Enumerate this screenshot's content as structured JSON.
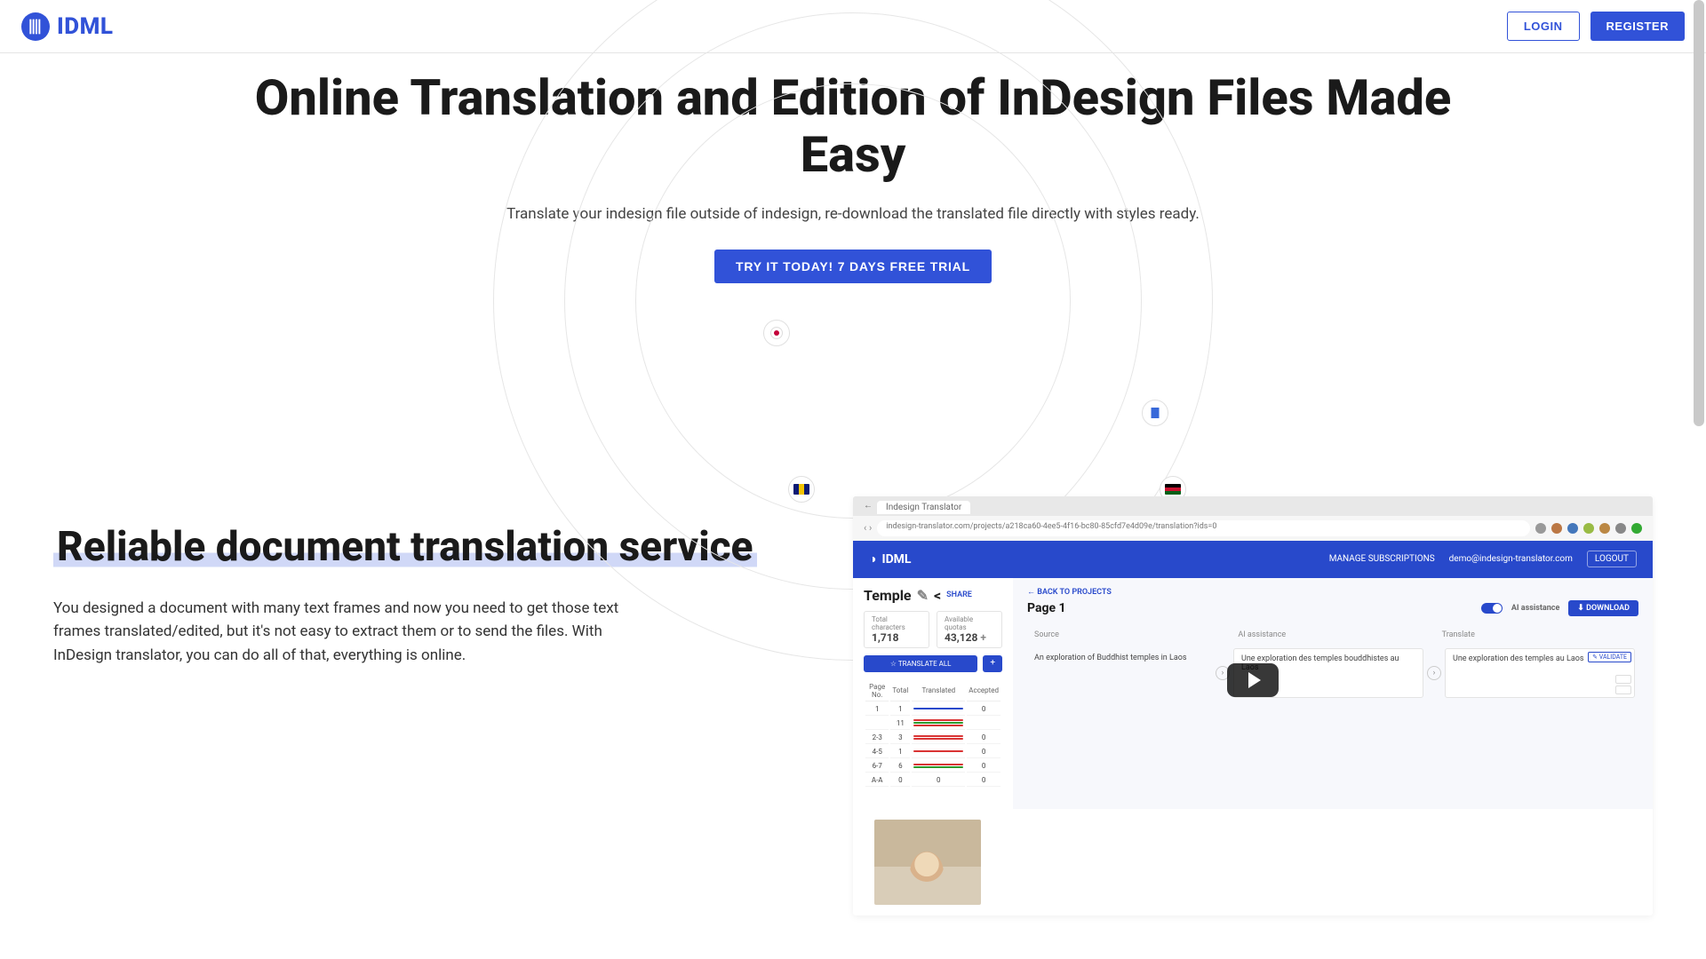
{
  "header": {
    "brand": "IDML",
    "login": "LOGIN",
    "register": "REGISTER"
  },
  "hero": {
    "title": "Online Translation and Edition of InDesign Files Made Easy",
    "subtitle": "Translate your indesign file outside of indesign, re-download the translated file directly with styles ready.",
    "cta": "TRY IT TODAY! 7 DAYS FREE TRIAL"
  },
  "section2": {
    "title": "Reliable document translation service",
    "body": "You designed a document with many text frames and now you need to get those text frames translated/edited, but it's not easy to extract them or to send the files. With InDesign translator, you can do all of that, everything is online."
  },
  "screenshot": {
    "tab": "Indesign Translator",
    "url": "indesign-translator.com/projects/a218ca60-4ee5-4f16-bc80-85cfd7e4d09e/translation?ids=0",
    "app_brand": "IDML",
    "manage_subs": "MANAGE SUBSCRIPTIONS",
    "user_email": "demo@indesign-translator.com",
    "logout": "LOGOUT",
    "project_name": "Temple",
    "share": "SHARE",
    "stats": {
      "chars_label": "Total characters",
      "chars_val": "1,718",
      "quotas_label": "Available quotas",
      "quotas_val": "43,128"
    },
    "translate_all": "TRANSLATE ALL",
    "table_headers": [
      "Page No.",
      "Total",
      "Translated",
      "Accepted"
    ],
    "pages": [
      {
        "no": "1",
        "total": "1",
        "translated": "1",
        "accepted": "0"
      },
      {
        "no": "",
        "total": "11",
        "translated": "",
        "accepted": ""
      },
      {
        "no": "2-3",
        "total": "3",
        "translated": "",
        "accepted": "0"
      },
      {
        "no": "4-5",
        "total": "1",
        "translated": "",
        "accepted": "0"
      },
      {
        "no": "6-7",
        "total": "6",
        "translated": "",
        "accepted": "0"
      },
      {
        "no": "A-A",
        "total": "0",
        "translated": "0",
        "accepted": "0"
      }
    ],
    "back": "BACK TO PROJECTS",
    "page_heading": "Page 1",
    "ai_assist": "AI assistance",
    "download": "DOWNLOAD",
    "cols": [
      "Source",
      "AI assistance",
      "Translate"
    ],
    "source_text": "An exploration of Buddhist temples in Laos",
    "ai_text": "Une exploration des temples bouddhistes au Laos",
    "translate_text": "Une exploration des temples au Laos",
    "validate": "VALIDATE"
  }
}
